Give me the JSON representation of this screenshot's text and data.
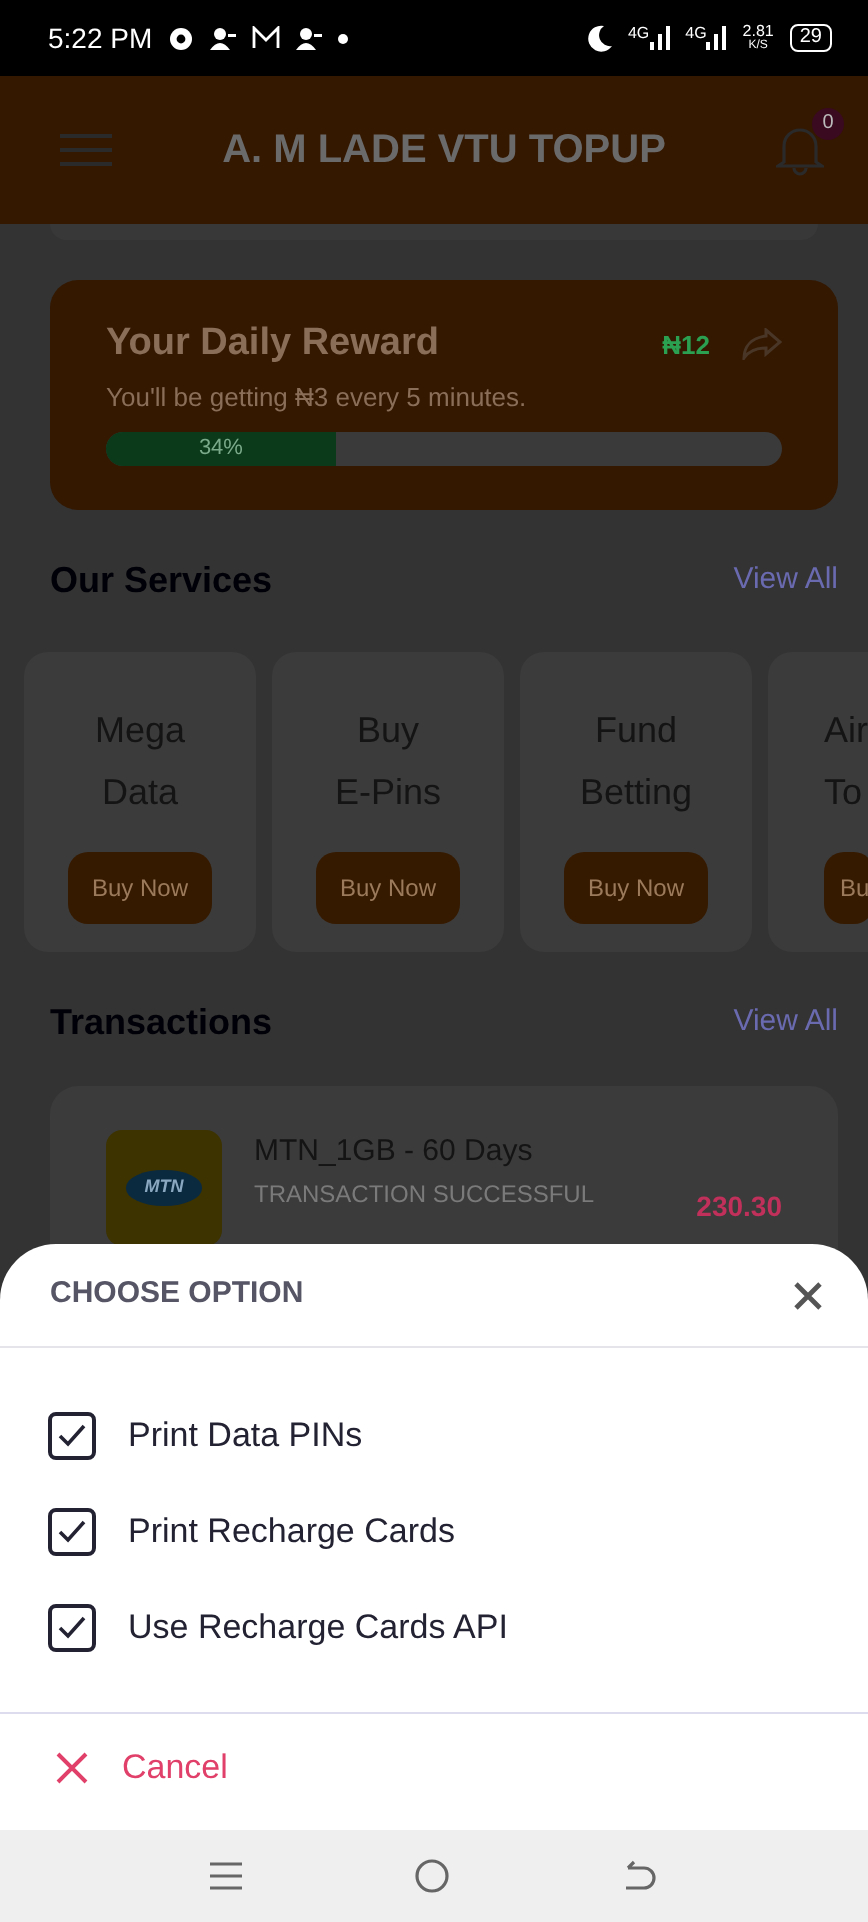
{
  "status_bar": {
    "time": "5:22 PM",
    "network_1": "4G",
    "network_2": "4G",
    "speed_value": "2.81",
    "speed_unit": "K/S",
    "battery": "29"
  },
  "app_bar": {
    "title": "A. M LADE VTU TOPUP",
    "notification_count": "0"
  },
  "reward": {
    "title": "Your Daily Reward",
    "amount": "₦12",
    "subtitle": "You'll be getting ₦3 every 5 minutes.",
    "level": 0.34,
    "progress_label": "34%"
  },
  "services": {
    "title": "Our Services",
    "view_all": "View All",
    "items": [
      {
        "line_1": "Mega",
        "line_2": "Data",
        "button": "Buy Now"
      },
      {
        "line_1": "Buy",
        "line_2": "E-Pins",
        "button": "Buy Now"
      },
      {
        "line_1": "Fund",
        "line_2": "Betting",
        "button": "Buy Now"
      },
      {
        "line_1": "Air",
        "line_2": "To",
        "button": "Bu"
      }
    ]
  },
  "transactions": {
    "title": "Transactions",
    "view_all": "View All",
    "items": [
      {
        "name": "MTN_1GB - 60 Days",
        "status": "TRANSACTION SUCCESSFUL",
        "amount": "230.30",
        "logo_text": "MTN"
      }
    ]
  },
  "sheet": {
    "title": "CHOOSE OPTION",
    "options": [
      {
        "label": "Print Data PINs",
        "checked": true
      },
      {
        "label": "Print Recharge Cards",
        "checked": true
      },
      {
        "label": "Use Recharge Cards API",
        "checked": true
      }
    ],
    "cancel": "Cancel"
  }
}
